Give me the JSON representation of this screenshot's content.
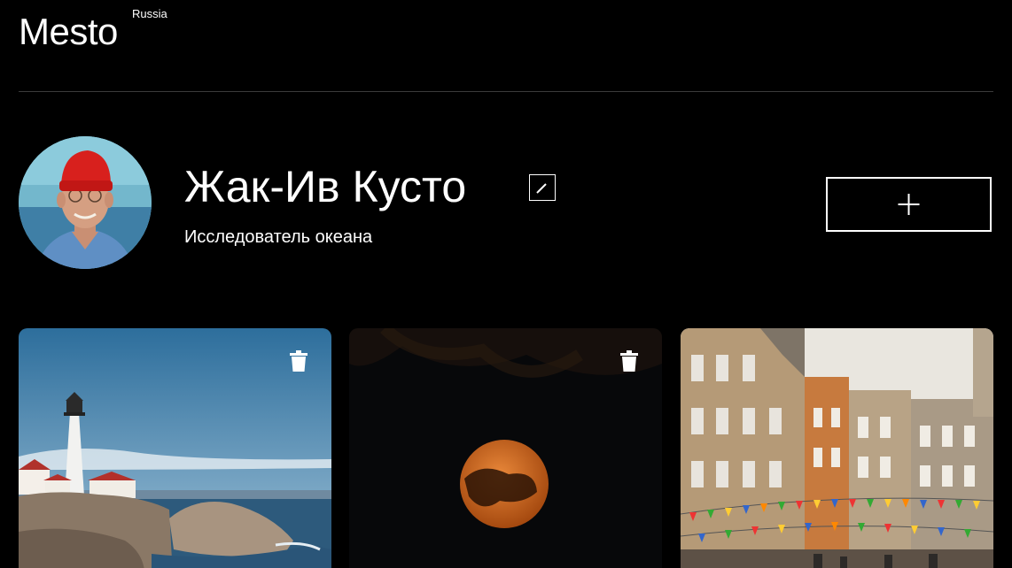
{
  "header": {
    "logo": "Mesto",
    "region": "Russia"
  },
  "profile": {
    "name": "Жак-Ив Кусто",
    "about": "Исследователь океана",
    "avatar_icon": "avatar-photo",
    "edit_icon": "pencil-icon",
    "add_icon": "plus-icon"
  },
  "cards": [
    {
      "image_icon": "lighthouse-photo",
      "delete_icon": "trash-icon"
    },
    {
      "image_icon": "moon-photo",
      "delete_icon": "trash-icon"
    },
    {
      "image_icon": "old-town-street-photo"
    }
  ],
  "colors": {
    "background": "#000000",
    "text": "#ffffff",
    "divider": "#545454"
  }
}
